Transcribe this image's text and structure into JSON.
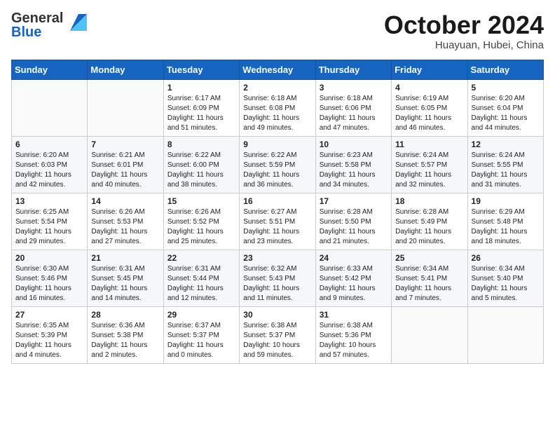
{
  "header": {
    "brand_general": "General",
    "brand_blue": "Blue",
    "month_title": "October 2024",
    "location": "Huayuan, Hubei, China"
  },
  "weekdays": [
    "Sunday",
    "Monday",
    "Tuesday",
    "Wednesday",
    "Thursday",
    "Friday",
    "Saturday"
  ],
  "weeks": [
    [
      {
        "day": "",
        "sunrise": "",
        "sunset": "",
        "daylight": ""
      },
      {
        "day": "",
        "sunrise": "",
        "sunset": "",
        "daylight": ""
      },
      {
        "day": "1",
        "sunrise": "Sunrise: 6:17 AM",
        "sunset": "Sunset: 6:09 PM",
        "daylight": "Daylight: 11 hours and 51 minutes."
      },
      {
        "day": "2",
        "sunrise": "Sunrise: 6:18 AM",
        "sunset": "Sunset: 6:08 PM",
        "daylight": "Daylight: 11 hours and 49 minutes."
      },
      {
        "day": "3",
        "sunrise": "Sunrise: 6:18 AM",
        "sunset": "Sunset: 6:06 PM",
        "daylight": "Daylight: 11 hours and 47 minutes."
      },
      {
        "day": "4",
        "sunrise": "Sunrise: 6:19 AM",
        "sunset": "Sunset: 6:05 PM",
        "daylight": "Daylight: 11 hours and 46 minutes."
      },
      {
        "day": "5",
        "sunrise": "Sunrise: 6:20 AM",
        "sunset": "Sunset: 6:04 PM",
        "daylight": "Daylight: 11 hours and 44 minutes."
      }
    ],
    [
      {
        "day": "6",
        "sunrise": "Sunrise: 6:20 AM",
        "sunset": "Sunset: 6:03 PM",
        "daylight": "Daylight: 11 hours and 42 minutes."
      },
      {
        "day": "7",
        "sunrise": "Sunrise: 6:21 AM",
        "sunset": "Sunset: 6:01 PM",
        "daylight": "Daylight: 11 hours and 40 minutes."
      },
      {
        "day": "8",
        "sunrise": "Sunrise: 6:22 AM",
        "sunset": "Sunset: 6:00 PM",
        "daylight": "Daylight: 11 hours and 38 minutes."
      },
      {
        "day": "9",
        "sunrise": "Sunrise: 6:22 AM",
        "sunset": "Sunset: 5:59 PM",
        "daylight": "Daylight: 11 hours and 36 minutes."
      },
      {
        "day": "10",
        "sunrise": "Sunrise: 6:23 AM",
        "sunset": "Sunset: 5:58 PM",
        "daylight": "Daylight: 11 hours and 34 minutes."
      },
      {
        "day": "11",
        "sunrise": "Sunrise: 6:24 AM",
        "sunset": "Sunset: 5:57 PM",
        "daylight": "Daylight: 11 hours and 32 minutes."
      },
      {
        "day": "12",
        "sunrise": "Sunrise: 6:24 AM",
        "sunset": "Sunset: 5:55 PM",
        "daylight": "Daylight: 11 hours and 31 minutes."
      }
    ],
    [
      {
        "day": "13",
        "sunrise": "Sunrise: 6:25 AM",
        "sunset": "Sunset: 5:54 PM",
        "daylight": "Daylight: 11 hours and 29 minutes."
      },
      {
        "day": "14",
        "sunrise": "Sunrise: 6:26 AM",
        "sunset": "Sunset: 5:53 PM",
        "daylight": "Daylight: 11 hours and 27 minutes."
      },
      {
        "day": "15",
        "sunrise": "Sunrise: 6:26 AM",
        "sunset": "Sunset: 5:52 PM",
        "daylight": "Daylight: 11 hours and 25 minutes."
      },
      {
        "day": "16",
        "sunrise": "Sunrise: 6:27 AM",
        "sunset": "Sunset: 5:51 PM",
        "daylight": "Daylight: 11 hours and 23 minutes."
      },
      {
        "day": "17",
        "sunrise": "Sunrise: 6:28 AM",
        "sunset": "Sunset: 5:50 PM",
        "daylight": "Daylight: 11 hours and 21 minutes."
      },
      {
        "day": "18",
        "sunrise": "Sunrise: 6:28 AM",
        "sunset": "Sunset: 5:49 PM",
        "daylight": "Daylight: 11 hours and 20 minutes."
      },
      {
        "day": "19",
        "sunrise": "Sunrise: 6:29 AM",
        "sunset": "Sunset: 5:48 PM",
        "daylight": "Daylight: 11 hours and 18 minutes."
      }
    ],
    [
      {
        "day": "20",
        "sunrise": "Sunrise: 6:30 AM",
        "sunset": "Sunset: 5:46 PM",
        "daylight": "Daylight: 11 hours and 16 minutes."
      },
      {
        "day": "21",
        "sunrise": "Sunrise: 6:31 AM",
        "sunset": "Sunset: 5:45 PM",
        "daylight": "Daylight: 11 hours and 14 minutes."
      },
      {
        "day": "22",
        "sunrise": "Sunrise: 6:31 AM",
        "sunset": "Sunset: 5:44 PM",
        "daylight": "Daylight: 11 hours and 12 minutes."
      },
      {
        "day": "23",
        "sunrise": "Sunrise: 6:32 AM",
        "sunset": "Sunset: 5:43 PM",
        "daylight": "Daylight: 11 hours and 11 minutes."
      },
      {
        "day": "24",
        "sunrise": "Sunrise: 6:33 AM",
        "sunset": "Sunset: 5:42 PM",
        "daylight": "Daylight: 11 hours and 9 minutes."
      },
      {
        "day": "25",
        "sunrise": "Sunrise: 6:34 AM",
        "sunset": "Sunset: 5:41 PM",
        "daylight": "Daylight: 11 hours and 7 minutes."
      },
      {
        "day": "26",
        "sunrise": "Sunrise: 6:34 AM",
        "sunset": "Sunset: 5:40 PM",
        "daylight": "Daylight: 11 hours and 5 minutes."
      }
    ],
    [
      {
        "day": "27",
        "sunrise": "Sunrise: 6:35 AM",
        "sunset": "Sunset: 5:39 PM",
        "daylight": "Daylight: 11 hours and 4 minutes."
      },
      {
        "day": "28",
        "sunrise": "Sunrise: 6:36 AM",
        "sunset": "Sunset: 5:38 PM",
        "daylight": "Daylight: 11 hours and 2 minutes."
      },
      {
        "day": "29",
        "sunrise": "Sunrise: 6:37 AM",
        "sunset": "Sunset: 5:37 PM",
        "daylight": "Daylight: 11 hours and 0 minutes."
      },
      {
        "day": "30",
        "sunrise": "Sunrise: 6:38 AM",
        "sunset": "Sunset: 5:37 PM",
        "daylight": "Daylight: 10 hours and 59 minutes."
      },
      {
        "day": "31",
        "sunrise": "Sunrise: 6:38 AM",
        "sunset": "Sunset: 5:36 PM",
        "daylight": "Daylight: 10 hours and 57 minutes."
      },
      {
        "day": "",
        "sunrise": "",
        "sunset": "",
        "daylight": ""
      },
      {
        "day": "",
        "sunrise": "",
        "sunset": "",
        "daylight": ""
      }
    ]
  ]
}
